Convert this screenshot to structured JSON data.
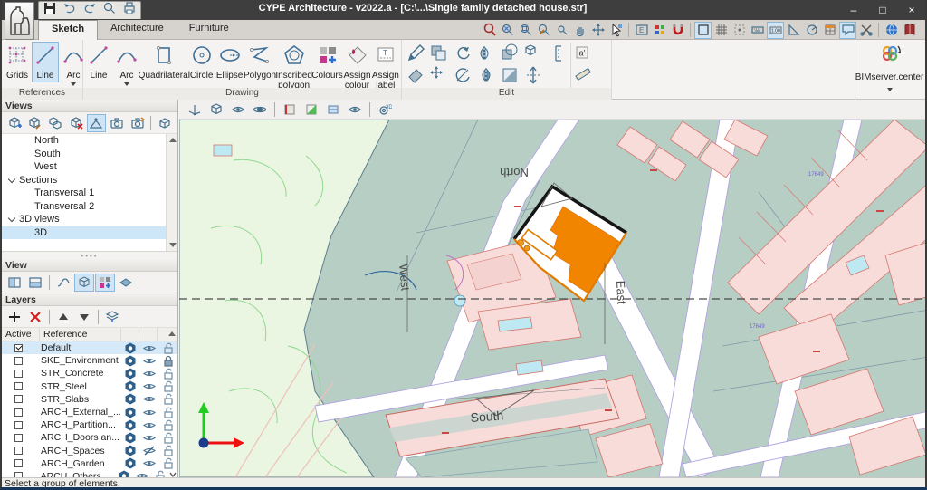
{
  "window": {
    "title": "CYPE Architecture - v2022.a - [C:\\...\\Single family detached house.str]",
    "controls": {
      "minimize": "–",
      "maximize": "□",
      "close": "×"
    }
  },
  "tabs": [
    {
      "label": "Sketch",
      "active": true
    },
    {
      "label": "Architecture",
      "active": false
    },
    {
      "label": "Furniture",
      "active": false
    }
  ],
  "ribbon": {
    "references": {
      "label": "References",
      "items": [
        {
          "label": "Grids",
          "icon": "grids"
        },
        {
          "label": "Line",
          "icon": "lineBig",
          "selected": true
        },
        {
          "label": "Arc",
          "icon": "arcBig",
          "dropdown": true
        }
      ]
    },
    "drawing": {
      "label": "Drawing",
      "items": [
        {
          "label": "Line",
          "icon": "lineBig"
        },
        {
          "label": "Arc",
          "icon": "arcBig",
          "dropdown": true
        },
        {
          "label": "Quadrilateral",
          "icon": "quad"
        },
        {
          "label": "Circle",
          "icon": "circleBig"
        },
        {
          "label": "Ellipse",
          "icon": "ellipseBig"
        },
        {
          "label": "Polygon",
          "icon": "poly"
        },
        {
          "label": "Inscribed\npolygon",
          "icon": "pentagon"
        },
        {
          "label": "Colours",
          "icon": "colours"
        },
        {
          "label": "Assign\ncolour",
          "icon": "assignColour"
        },
        {
          "label": "Assign\nlabel",
          "icon": "assignLabel"
        }
      ]
    },
    "edit": {
      "label": "Edit",
      "row1": [
        "pencil",
        "copy",
        "rotate",
        "mirror",
        "intersect",
        "box3d",
        "dimension"
      ],
      "row2": [
        "eraser",
        "move4",
        "rotateAngle",
        "mirrorCopy",
        "invert",
        "stretch"
      ],
      "extra": [
        "textA",
        "measure"
      ]
    }
  },
  "bimserver": {
    "label": "BIMserver.center"
  },
  "views_panel": {
    "title": "Views",
    "tree": [
      {
        "label": "North",
        "type": "leaf"
      },
      {
        "label": "South",
        "type": "leaf"
      },
      {
        "label": "West",
        "type": "leaf"
      },
      {
        "label": "Sections",
        "type": "group"
      },
      {
        "label": "Transversal 1",
        "type": "leaf"
      },
      {
        "label": "Transversal 2",
        "type": "leaf"
      },
      {
        "label": "3D views",
        "type": "group"
      },
      {
        "label": "3D",
        "type": "leaf",
        "selected": true
      }
    ]
  },
  "view_panel": {
    "title": "View"
  },
  "layers_panel": {
    "title": "Layers",
    "columns": {
      "active": "Active",
      "reference": "Reference"
    },
    "rows": [
      {
        "name": "Default",
        "active": true,
        "selected": true,
        "visible": true,
        "locked": false
      },
      {
        "name": "SKE_Environment",
        "active": false,
        "visible": true,
        "locked": true
      },
      {
        "name": "STR_Concrete",
        "active": false,
        "visible": true,
        "locked": false
      },
      {
        "name": "STR_Steel",
        "active": false,
        "visible": true,
        "locked": false
      },
      {
        "name": "STR_Slabs",
        "active": false,
        "visible": true,
        "locked": false
      },
      {
        "name": "ARCH_External_...",
        "active": false,
        "visible": true,
        "locked": false
      },
      {
        "name": "ARCH_Partition...",
        "active": false,
        "visible": true,
        "locked": false
      },
      {
        "name": "ARCH_Doors an...",
        "active": false,
        "visible": true,
        "locked": false
      },
      {
        "name": "ARCH_Spaces",
        "active": false,
        "visible": false,
        "locked": false
      },
      {
        "name": "ARCH_Garden",
        "active": false,
        "visible": true,
        "locked": false
      },
      {
        "name": "ARCH_Others",
        "active": false,
        "visible": true,
        "locked": false
      }
    ]
  },
  "statusbar": {
    "text": "Select a group of elements."
  },
  "map": {
    "direction_labels": {
      "north": "North",
      "south": "South",
      "east": "East",
      "west": "West"
    },
    "parcel_labels": [
      "17649",
      "17649"
    ]
  },
  "colors": {
    "selection": "#cfe4f5",
    "orange_fill": "#f28500",
    "teal": "#b7cec5",
    "field_green": "#eaf6e2",
    "pink": "#f8dcda",
    "pink_outline": "#d4776e",
    "road_edge": "#b0a3e0",
    "icon_blue": "#44708e"
  }
}
